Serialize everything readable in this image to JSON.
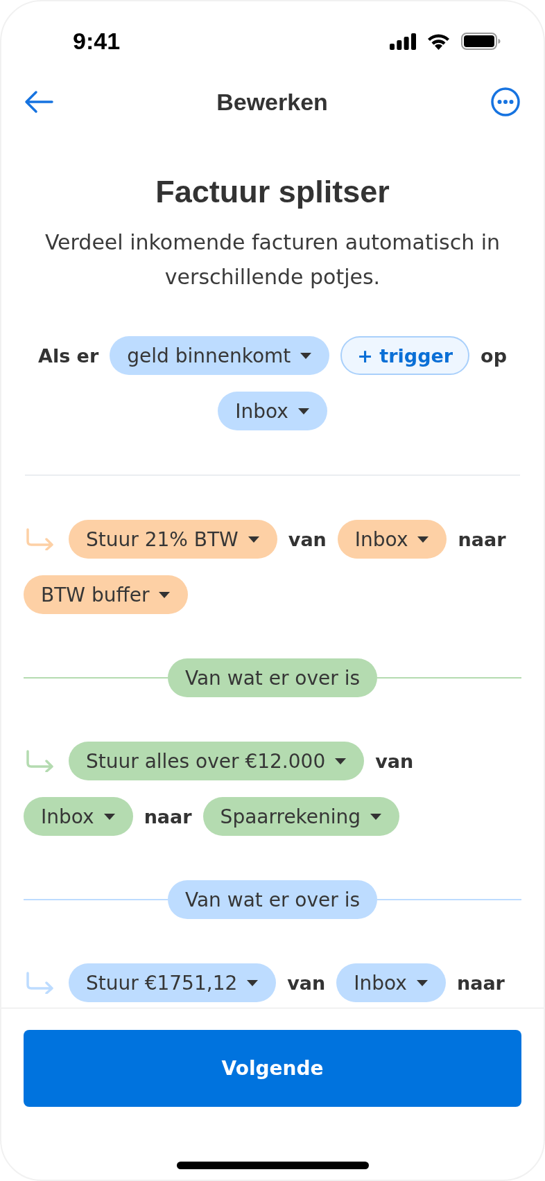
{
  "status_bar": {
    "time": "9:41"
  },
  "header": {
    "title": "Bewerken"
  },
  "intro": {
    "title": "Factuur splitser",
    "description": "Verdeel inkomende facturen automatisch in verschillende potjes."
  },
  "trigger": {
    "lines": [
      [
        {
          "kind": "text",
          "text": "Als er"
        },
        {
          "kind": "dropdown",
          "text": "geld binnenkomt"
        },
        {
          "kind": "add",
          "text": "+ trigger"
        },
        {
          "kind": "text",
          "text": "op"
        }
      ],
      [
        {
          "kind": "dropdown",
          "text": "Inbox"
        }
      ]
    ]
  },
  "rules": [
    {
      "color": "#fdd0a5",
      "lines": [
        [
          {
            "kind": "dropdown",
            "text": "Stuur 21% BTW"
          },
          {
            "kind": "text",
            "text": "van"
          },
          {
            "kind": "dropdown",
            "text": "Inbox"
          },
          {
            "kind": "text",
            "text": "naar"
          }
        ],
        [
          {
            "kind": "dropdown",
            "text": "BTW buffer"
          }
        ]
      ]
    },
    {
      "color": "#b4dbb0",
      "separator": "Van wat er over is",
      "lines": [
        [
          {
            "kind": "dropdown",
            "text": "Stuur alles over €12.000"
          },
          {
            "kind": "text",
            "text": "van"
          }
        ],
        [
          {
            "kind": "dropdown",
            "text": "Inbox"
          },
          {
            "kind": "text",
            "text": "naar"
          },
          {
            "kind": "dropdown",
            "text": "Spaarrekening"
          }
        ]
      ]
    },
    {
      "color": "#bddcff",
      "separator": "Van wat er over is",
      "lines": [
        [
          {
            "kind": "dropdown",
            "text": "Stuur €1751,12"
          },
          {
            "kind": "text",
            "text": "van"
          },
          {
            "kind": "dropdown",
            "text": "Inbox"
          },
          {
            "kind": "text",
            "text": "naar"
          }
        ]
      ]
    }
  ],
  "footer": {
    "button": "Volgende"
  }
}
